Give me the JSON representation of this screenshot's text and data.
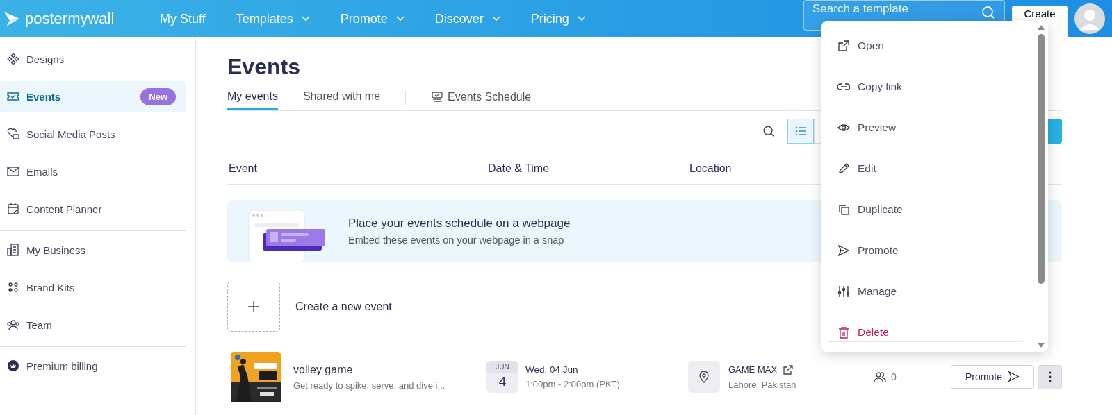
{
  "header": {
    "logo": "postermywall",
    "nav": [
      {
        "label": "My Stuff",
        "dropdown": false
      },
      {
        "label": "Templates",
        "dropdown": true
      },
      {
        "label": "Promote",
        "dropdown": true
      },
      {
        "label": "Discover",
        "dropdown": true
      },
      {
        "label": "Pricing",
        "dropdown": true
      }
    ],
    "search": {
      "placeholder": "Search a template"
    },
    "create_button": "Create"
  },
  "sidebar": {
    "groups": [
      [
        {
          "label": "Designs",
          "selected": false
        },
        {
          "label": "Events",
          "selected": true,
          "badge": "New"
        },
        {
          "label": "Social Media Posts",
          "selected": false
        },
        {
          "label": "Emails",
          "selected": false
        },
        {
          "label": "Content Planner",
          "selected": false
        }
      ],
      [
        {
          "label": "My Business",
          "selected": false
        },
        {
          "label": "Brand Kits",
          "selected": false
        },
        {
          "label": "Team",
          "selected": false
        }
      ],
      [
        {
          "label": "Premium billing",
          "selected": false
        }
      ]
    ]
  },
  "page": {
    "title": "Events",
    "tabs": [
      {
        "label": "My events",
        "selected": true
      },
      {
        "label": "Shared with me",
        "selected": false
      }
    ],
    "schedule_link": "Events Schedule",
    "view_toggle": [
      {
        "selected": true
      },
      {
        "selected": false
      }
    ],
    "table": {
      "columns": [
        "Event",
        "Date & Time",
        "Location"
      ]
    },
    "banner": {
      "title": "Place your events schedule on a webpage",
      "text": "Embed these events on your webpage in a snap"
    },
    "create_new": "Create a new event",
    "events": [
      {
        "name": "volley game",
        "description": "Get ready to spike, serve, and dive i...",
        "month": "JUN",
        "day": "4",
        "date": "Wed, 04 Jun",
        "time": "1:00pm - 2:00pm (PKT)",
        "location": "GAME MAX",
        "city": "Lahore, Pakistan",
        "attendees": "0",
        "promote": "Promote"
      }
    ]
  },
  "context_menu": {
    "items": [
      {
        "label": "Open",
        "kind": "normal"
      },
      {
        "label": "Copy link",
        "kind": "normal"
      },
      {
        "label": "Preview",
        "kind": "normal"
      },
      {
        "label": "Edit",
        "kind": "normal"
      },
      {
        "label": "Duplicate",
        "kind": "normal"
      },
      {
        "label": "Promote",
        "kind": "normal"
      },
      {
        "label": "Manage",
        "kind": "normal"
      },
      {
        "label": "Delete",
        "kind": "danger"
      }
    ]
  }
}
